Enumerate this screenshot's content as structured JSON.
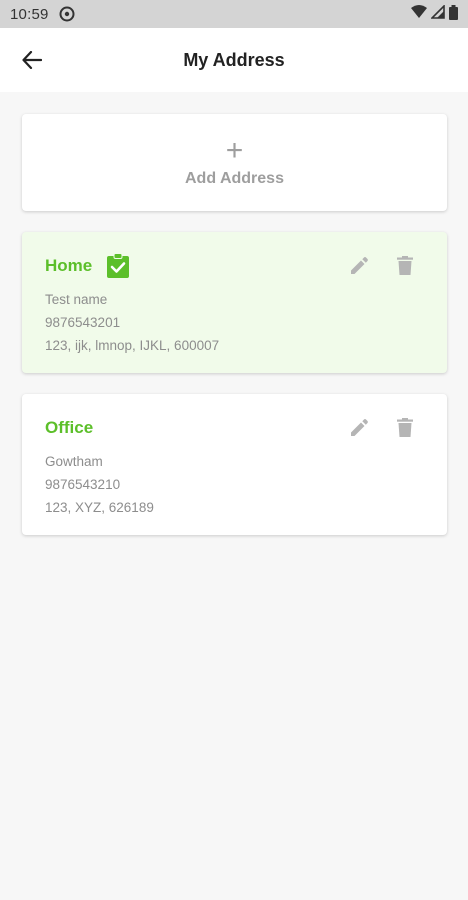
{
  "status_bar": {
    "time": "10:59"
  },
  "header": {
    "title": "My Address"
  },
  "add_address": {
    "plus": "+",
    "label": "Add Address"
  },
  "addresses": [
    {
      "type": "Home",
      "selected": true,
      "name": "Test name",
      "phone": "9876543201",
      "address": "123, ijk, lmnop, IJKL, 600007"
    },
    {
      "type": "Office",
      "selected": false,
      "name": "Gowtham",
      "phone": "9876543210",
      "address": "123, XYZ, 626189"
    }
  ],
  "colors": {
    "accent_green": "#5cbf2a",
    "selected_bg": "#f1fbea",
    "icon_gray": "#9e9e9e"
  }
}
